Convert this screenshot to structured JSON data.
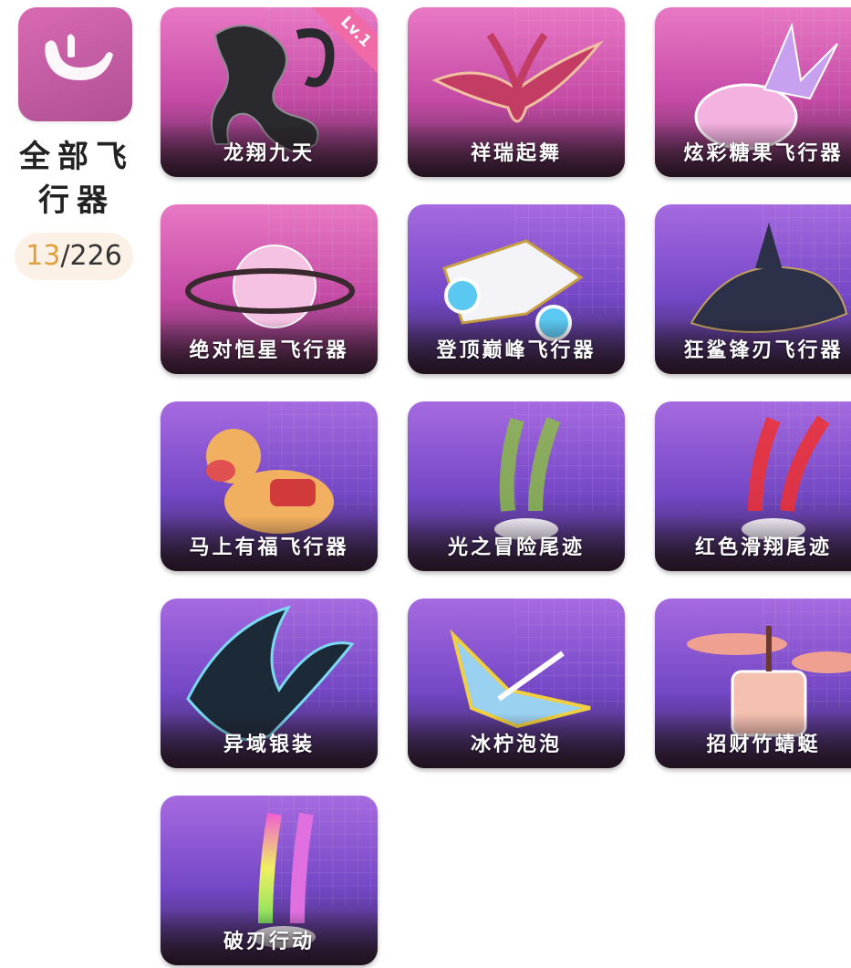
{
  "category": {
    "title": "全部飞行器",
    "owned": "13",
    "separator": "/",
    "total": "226",
    "icon": "flying-figure-icon"
  },
  "cards": [
    {
      "label": "龙翔九天",
      "badge": "Lv.1",
      "theme": "pink",
      "icon": "dragon-icon"
    },
    {
      "label": "祥瑞起舞",
      "theme": "pink",
      "icon": "winged-aircraft-icon"
    },
    {
      "label": "炫彩糖果飞行器",
      "theme": "pink",
      "icon": "candy-icon"
    },
    {
      "label": "绝对恒星飞行器",
      "theme": "pink",
      "icon": "planet-icon"
    },
    {
      "label": "登顶巅峰飞行器",
      "theme": "purple",
      "icon": "jet-icon"
    },
    {
      "label": "狂鲨锋刃飞行器",
      "theme": "purple",
      "icon": "shark-icon"
    },
    {
      "label": "马上有福飞行器",
      "theme": "purple",
      "icon": "horse-icon"
    },
    {
      "label": "光之冒险尾迹",
      "theme": "purple",
      "icon": "green-trail-icon"
    },
    {
      "label": "红色滑翔尾迹",
      "theme": "purple",
      "icon": "red-trail-icon"
    },
    {
      "label": "异域银装",
      "theme": "purple",
      "icon": "dark-wings-icon"
    },
    {
      "label": "冰柠泡泡",
      "theme": "purple",
      "icon": "glider-icon"
    },
    {
      "label": "招财竹蜻蜓",
      "theme": "purple",
      "icon": "helicopter-icon"
    },
    {
      "label": "破刃行动",
      "theme": "purple",
      "icon": "rainbow-trail-icon"
    }
  ]
}
